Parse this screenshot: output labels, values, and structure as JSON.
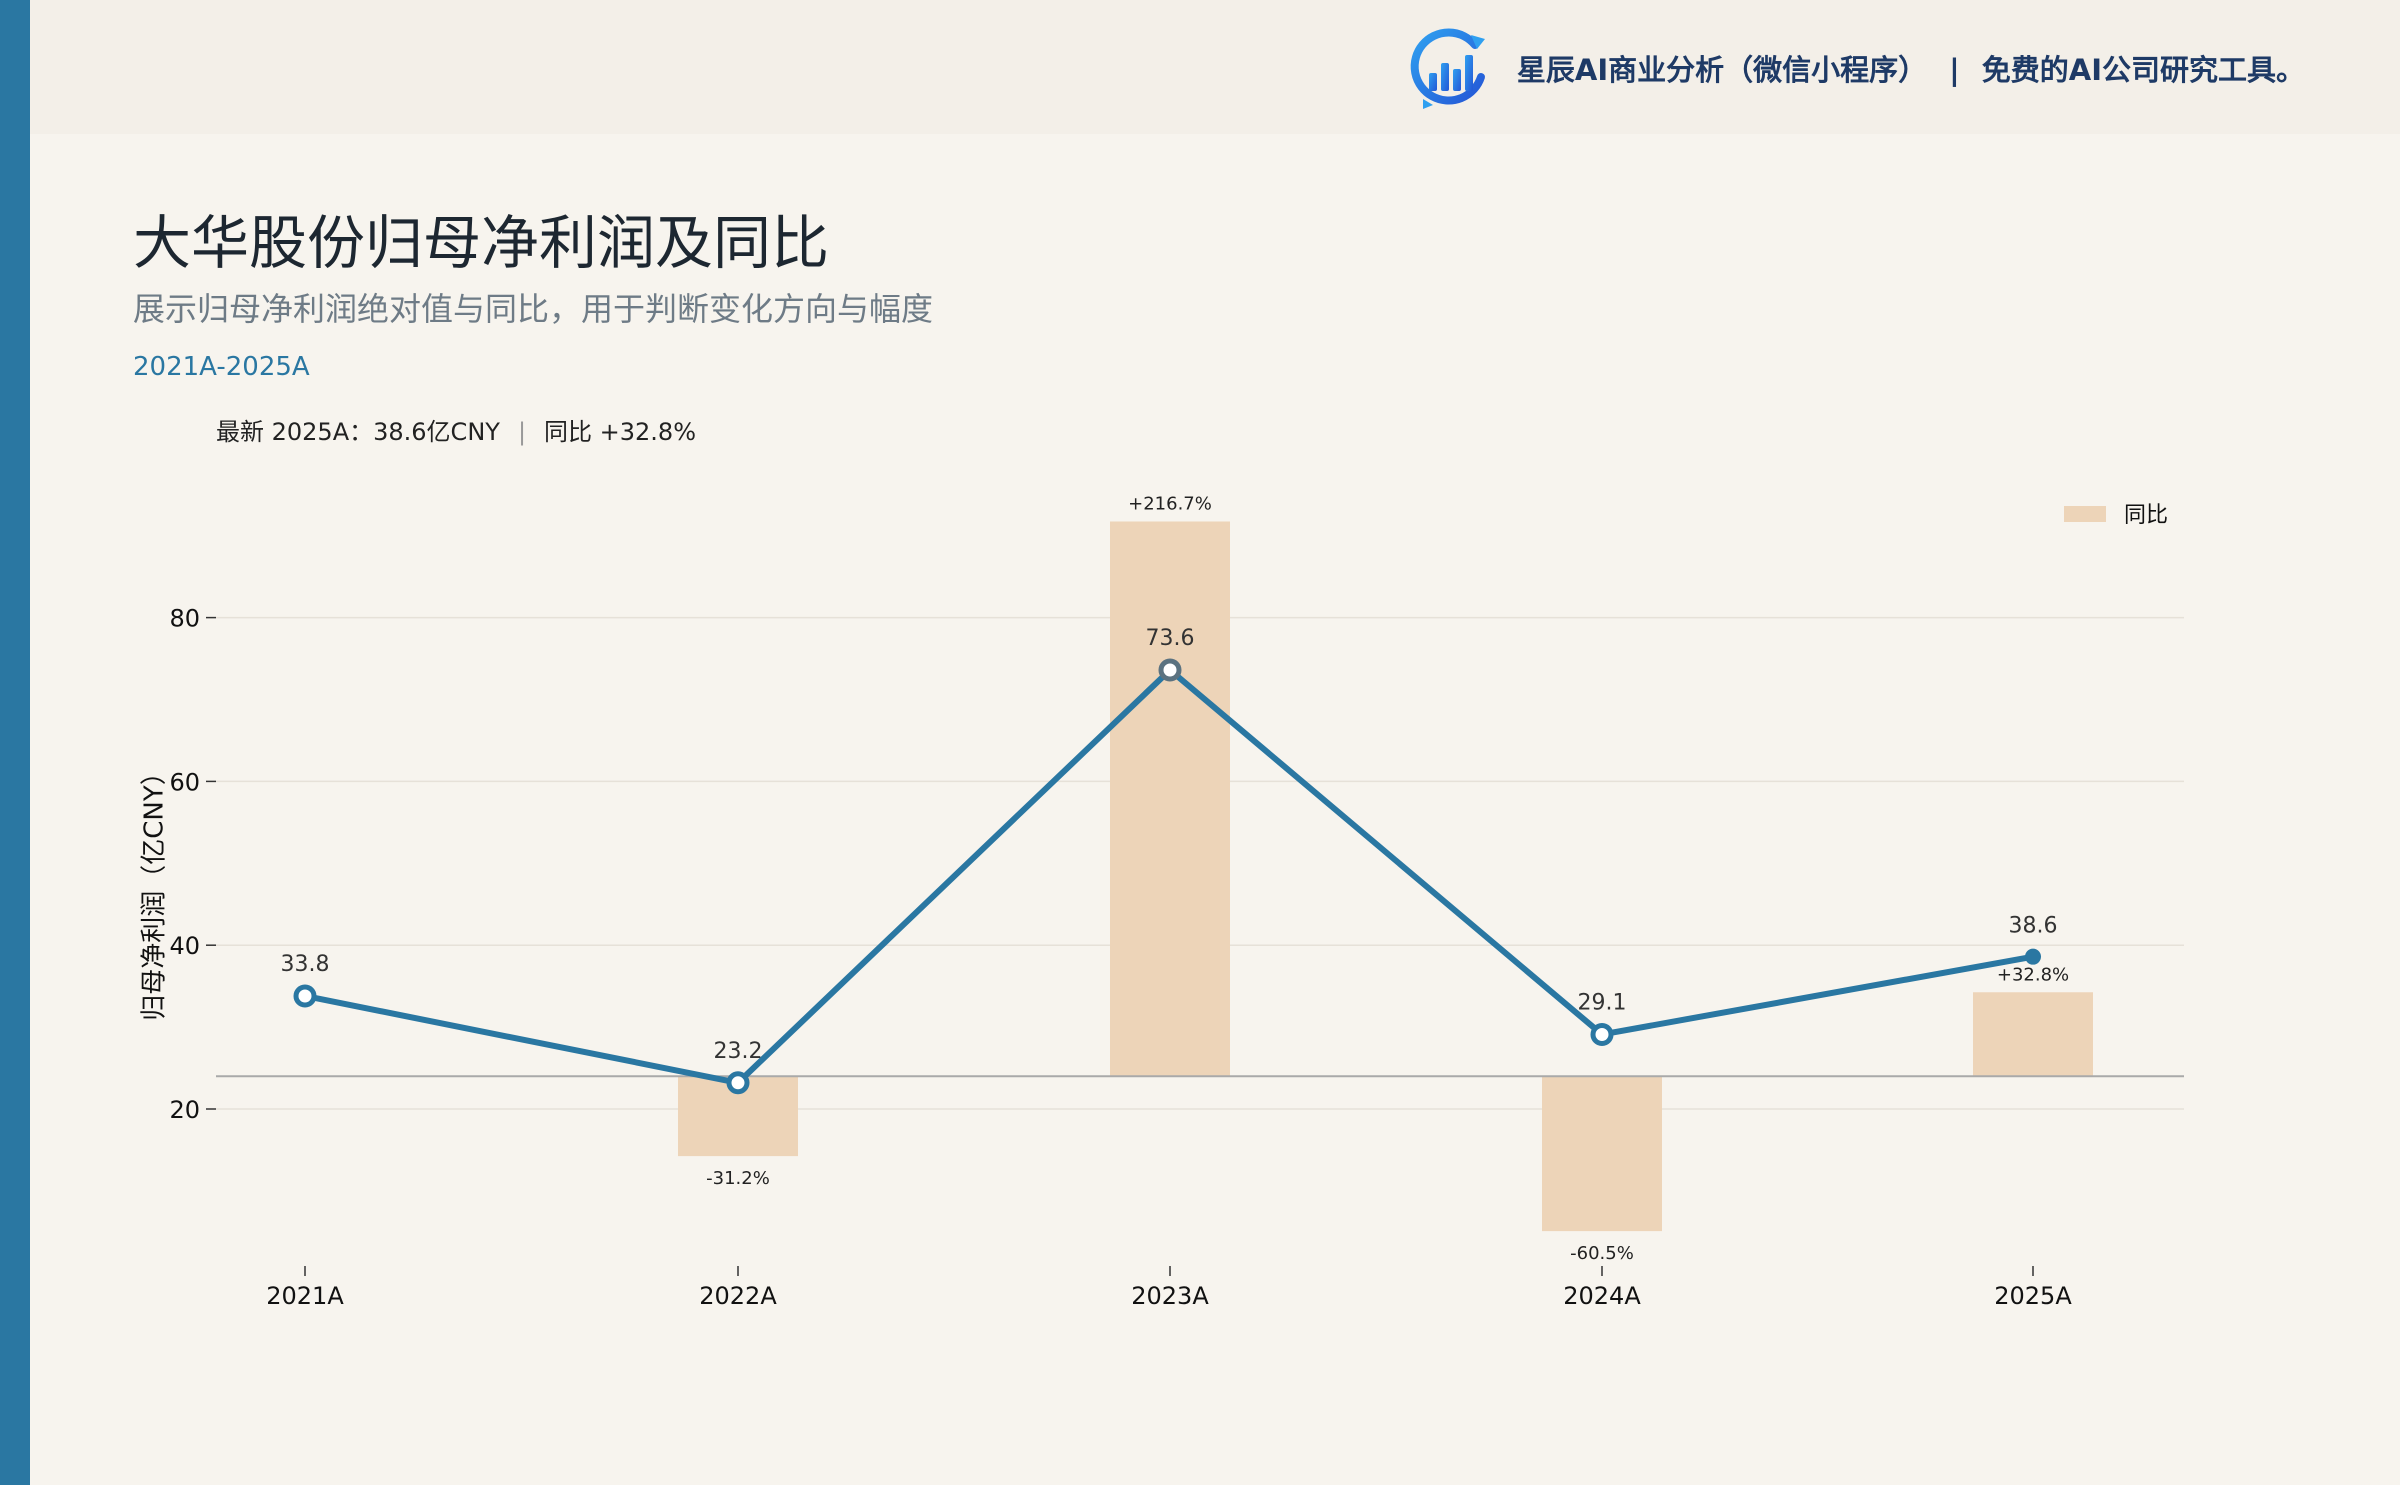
{
  "brand": {
    "text": "星辰AI商业分析（微信小程序）",
    "separator": "|",
    "tagline": "免费的AI公司研究工具。"
  },
  "header": {
    "title": "大华股份归母净利润及同比",
    "subtitle": "展示归母净利润绝对值与同比，用于判断变化方向与幅度",
    "range": "2021A-2025A",
    "latest": "最新 2025A：38.6亿CNY",
    "stat_separator": "|",
    "yoy": "同比 +32.8%"
  },
  "colors": {
    "accent": "#2a77a2",
    "bar": "#edd4b8",
    "background": "#f7f4ee",
    "brand_text": "#1e3a66"
  },
  "chart_data": {
    "type": "line",
    "categories": [
      "2021A",
      "2022A",
      "2023A",
      "2024A",
      "2025A"
    ],
    "ylabel": "归母净利润（亿CNY）",
    "yticks": [
      20,
      40,
      60,
      80
    ],
    "ylim": [
      1.5,
      95
    ],
    "grid": true,
    "legend": {
      "position": "top-right",
      "label": "同比"
    },
    "series": [
      {
        "values": [
          33.8,
          23.2,
          73.6,
          29.1,
          38.6
        ],
        "labels": [
          "33.8",
          "23.2",
          "73.6",
          "29.1",
          "38.6"
        ]
      }
    ],
    "yoy": {
      "baseline": 24.0,
      "values": [
        null,
        -31.2,
        216.7,
        -60.5,
        32.8
      ],
      "labels": [
        "",
        "-31.2%",
        "+216.7%",
        "-60.5%",
        "+32.8%"
      ]
    }
  }
}
